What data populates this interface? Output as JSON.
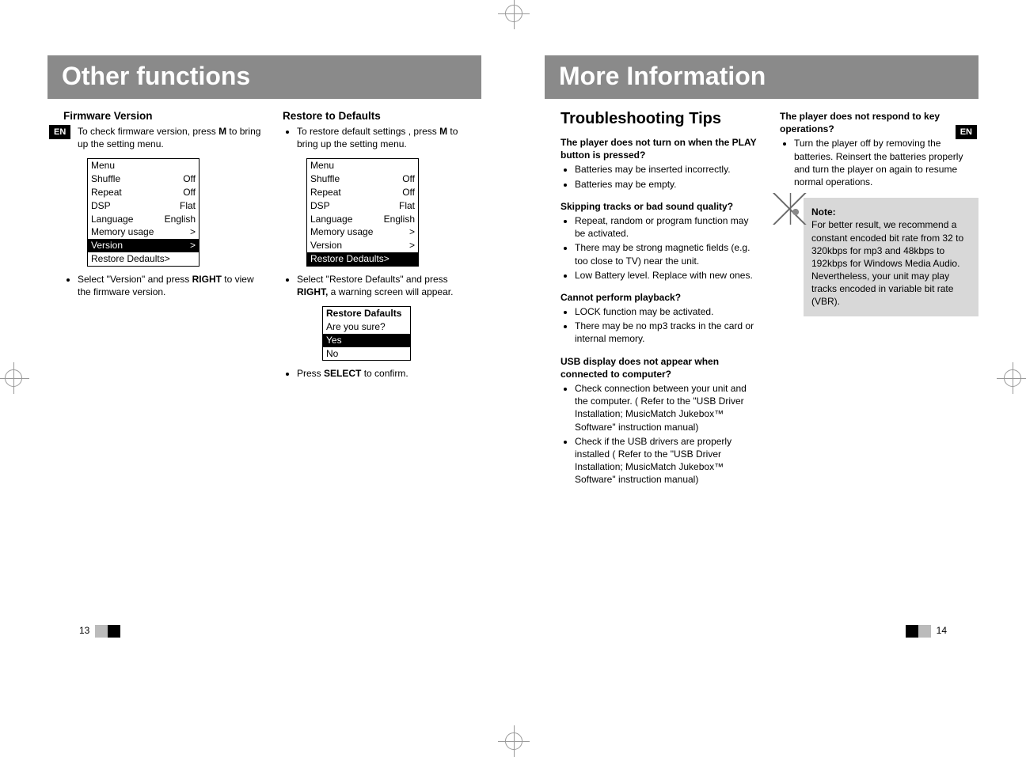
{
  "leftPage": {
    "header": "Other functions",
    "langTab": "EN",
    "pageNumber": "13",
    "col1": {
      "title": "Firmware Version",
      "step1_pre": "To check firmware version, press ",
      "step1_bold": "M",
      "step1_post": " to bring up the setting menu.",
      "menu": {
        "title": "Menu",
        "rows": [
          {
            "label": "Shuffle",
            "value": "Off",
            "sel": false
          },
          {
            "label": "Repeat",
            "value": "Off",
            "sel": false
          },
          {
            "label": "DSP",
            "value": "Flat",
            "sel": false
          },
          {
            "label": "Language",
            "value": "English",
            "sel": false
          },
          {
            "label": "Memory usage",
            "value": ">",
            "sel": false
          },
          {
            "label": "Version",
            "value": ">",
            "sel": true
          },
          {
            "label": "Restore Dedaults>",
            "value": "",
            "sel": false
          }
        ]
      },
      "step2_pre": "Select \"Version\" and press ",
      "step2_bold": "RIGHT",
      "step2_post": " to view the firmware version."
    },
    "col2": {
      "title": "Restore to Defaults",
      "step1_pre": "To restore default settings , press ",
      "step1_bold": "M",
      "step1_post": " to bring up the setting menu.",
      "menu": {
        "title": "Menu",
        "rows": [
          {
            "label": "Shuffle",
            "value": "Off",
            "sel": false
          },
          {
            "label": "Repeat",
            "value": "Off",
            "sel": false
          },
          {
            "label": "DSP",
            "value": "Flat",
            "sel": false
          },
          {
            "label": "Language",
            "value": "English",
            "sel": false
          },
          {
            "label": "Memory usage",
            "value": ">",
            "sel": false
          },
          {
            "label": "Version",
            "value": ">",
            "sel": false
          },
          {
            "label": "Restore Dedaults>",
            "value": "",
            "sel": true
          }
        ]
      },
      "step2_pre": "Select \"Restore Defaults\" and press ",
      "step2_bold": "RIGHT,",
      "step2_post": " a warning screen will appear.",
      "confirm": {
        "title": "Restore Dafaults",
        "prompt": "Are you sure?",
        "yes": "Yes",
        "no": "No"
      },
      "step3_pre": "Press ",
      "step3_bold": "SELECT",
      "step3_post": " to confirm."
    }
  },
  "rightPage": {
    "header": "More Information",
    "langTab": "EN",
    "pageNumber": "14",
    "col1": {
      "title": "Troubleshooting Tips",
      "items": [
        {
          "q": "The player does not turn on when the PLAY button is pressed?",
          "a": [
            "Batteries may be inserted incorrectly.",
            "Batteries may be empty."
          ]
        },
        {
          "q": "Skipping tracks or bad sound quality?",
          "a": [
            "Repeat, random or program function may be activated.",
            "There may be strong magnetic fields (e.g. too close to TV) near the unit.",
            "Low Battery level. Replace with new ones."
          ]
        },
        {
          "q": "Cannot perform playback?",
          "a": [
            "LOCK function may be activated.",
            "There may be no mp3 tracks in the card or internal memory."
          ]
        },
        {
          "q": "USB display does not appear when connected to computer?",
          "a": [
            "Check connection between your unit and the computer. ( Refer to the \"USB Driver Installation; MusicMatch Jukebox™ Software\"  instruction manual)",
            "Check if the USB drivers are properly installed ( Refer to the \"USB Driver Installation; MusicMatch Jukebox™ Software\"  instruction manual)"
          ]
        }
      ]
    },
    "col2": {
      "items": [
        {
          "q": "The player does not respond to key operations?",
          "a": [
            "Turn the player off by removing the batteries. Reinsert the batteries properly and turn the player on again to resume normal operations."
          ]
        }
      ],
      "note": {
        "title": "Note:",
        "body1": "For better result, we recommend a constant encoded bit rate from 32 to 320kbps for mp3 and 48kbps to 192kbps for Windows Media Audio.",
        "body2": "Nevertheless, your unit may play tracks encoded in variable bit rate (VBR)."
      }
    }
  }
}
